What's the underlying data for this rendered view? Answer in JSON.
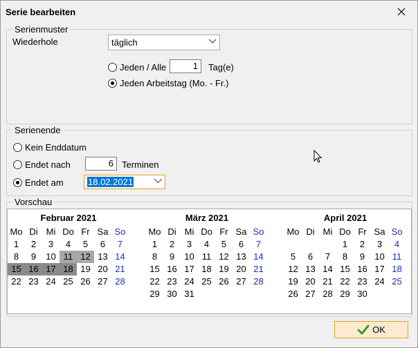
{
  "window": {
    "title": "Serie bearbeiten"
  },
  "pattern": {
    "legend": "Serienmuster",
    "repeat_label": "Wiederhole",
    "repeat_value": "täglich",
    "every_label": "Jeden / Alle",
    "every_value": "1",
    "every_unit": "Tag(e)",
    "workday_label": "Jeden Arbeitstag (Mo. - Fr.)",
    "selected": "workday"
  },
  "end": {
    "legend": "Serienende",
    "no_end_label": "Kein Enddatum",
    "after_label": "Endet nach",
    "after_value": "6",
    "after_unit": "Terminen",
    "on_label": "Endet am",
    "on_value": "18.02.2021",
    "selected": "on"
  },
  "preview": {
    "legend": "Vorschau",
    "weekdays": [
      "Mo",
      "Di",
      "Mi",
      "Do",
      "Fr",
      "Sa",
      "So"
    ],
    "months": [
      {
        "title": "Februar 2021",
        "weeks": [
          [
            "1",
            "2",
            "3",
            "4",
            "5",
            "6",
            "7"
          ],
          [
            "8",
            "9",
            "10",
            "11",
            "12",
            "13",
            "14"
          ],
          [
            "15",
            "16",
            "17",
            "18",
            "19",
            "20",
            "21"
          ],
          [
            "22",
            "23",
            "24",
            "25",
            "26",
            "27",
            "28"
          ]
        ],
        "highlighted": [
          "11",
          "12",
          "15",
          "16",
          "17",
          "18"
        ]
      },
      {
        "title": "März 2021",
        "weeks": [
          [
            "1",
            "2",
            "3",
            "4",
            "5",
            "6",
            "7"
          ],
          [
            "8",
            "9",
            "10",
            "11",
            "12",
            "13",
            "14"
          ],
          [
            "15",
            "16",
            "17",
            "18",
            "19",
            "20",
            "21"
          ],
          [
            "22",
            "23",
            "24",
            "25",
            "26",
            "27",
            "28"
          ],
          [
            "29",
            "30",
            "31",
            "",
            "",
            "",
            ""
          ]
        ],
        "highlighted": []
      },
      {
        "title": "April 2021",
        "weeks": [
          [
            "",
            "",
            "1",
            "2",
            "3",
            "4"
          ],
          [
            "5",
            "6",
            "7",
            "8",
            "9",
            "10",
            "11"
          ],
          [
            "12",
            "13",
            "14",
            "15",
            "16",
            "17",
            "18"
          ],
          [
            "19",
            "20",
            "21",
            "22",
            "23",
            "24",
            "25"
          ],
          [
            "26",
            "27",
            "28",
            "29",
            "30",
            "",
            ""
          ]
        ],
        "highlighted": []
      }
    ]
  },
  "ok_label": "OK",
  "colors": {
    "accent": "#e3a21a",
    "sunday": "#1a2bc4",
    "highlight": "#8a8a8a",
    "selection": "#0078d7",
    "ok_check": "#3a9a28"
  }
}
